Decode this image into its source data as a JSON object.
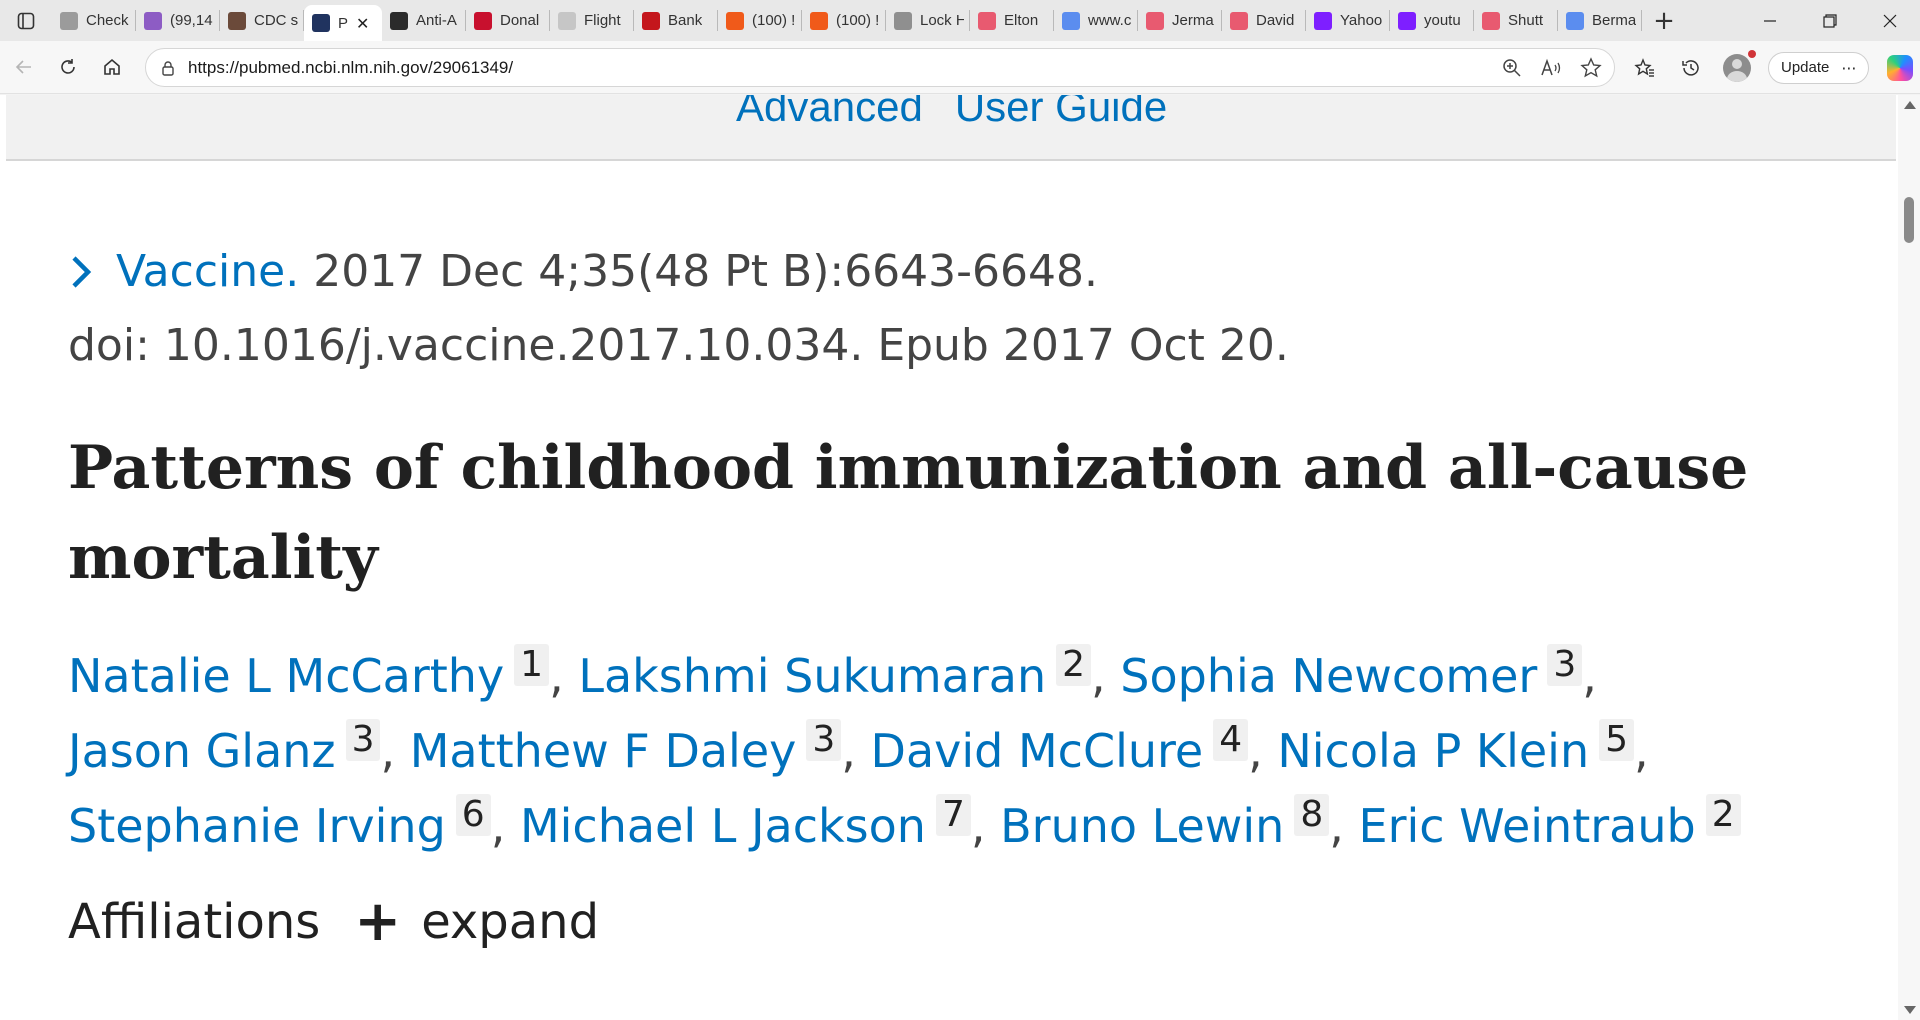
{
  "tabs": [
    {
      "title": "Check",
      "icon": "card-icon",
      "color": "#9b9b9b"
    },
    {
      "title": "(99,14",
      "icon": "mail-icon",
      "color": "#8d5cc4"
    },
    {
      "title": "CDC s",
      "icon": "photo-icon",
      "color": "#6b4a3a"
    },
    {
      "title": "P",
      "icon": "pubmed-icon",
      "color": "#20335f",
      "active": true
    },
    {
      "title": "Anti-A",
      "icon": "fp-icon",
      "color": "#2b2b2b"
    },
    {
      "title": "Donal",
      "icon": "news-icon",
      "color": "#c8102e"
    },
    {
      "title": "Flight",
      "icon": "plane-icon",
      "color": "#c6c6c6"
    },
    {
      "title": "Bank",
      "icon": "bank-icon",
      "color": "#c4161c"
    },
    {
      "title": "(100) !",
      "icon": "bookmark-icon",
      "color": "#f05a1a"
    },
    {
      "title": "(100) !",
      "icon": "bookmark-icon",
      "color": "#f05a1a"
    },
    {
      "title": "Lock H",
      "icon": "gp-icon",
      "color": "#8f8f8f"
    },
    {
      "title": "Elton",
      "icon": "youtube-icon",
      "color": "#e85a70"
    },
    {
      "title": "www.c",
      "icon": "search-icon",
      "color": "#5b8def"
    },
    {
      "title": "Jerma",
      "icon": "youtube-icon",
      "color": "#e85a70"
    },
    {
      "title": "David",
      "icon": "youtube-icon",
      "color": "#e85a70"
    },
    {
      "title": "Yahoo",
      "icon": "yahoo-icon",
      "color": "#7e1fff"
    },
    {
      "title": "youtu",
      "icon": "yahoo-icon",
      "color": "#7e1fff"
    },
    {
      "title": "Shutt",
      "icon": "youtube-icon",
      "color": "#e85a70"
    },
    {
      "title": "Berma",
      "icon": "search-icon",
      "color": "#5b8def"
    }
  ],
  "toolbar": {
    "url": "https://pubmed.ncbi.nlm.nih.gov/29061349/",
    "update_label": "Update",
    "more_label": "⋯"
  },
  "search": {
    "advanced_label": "Advanced",
    "user_guide_label": "User Guide"
  },
  "article": {
    "journal": "Vaccine.",
    "citation": "2017 Dec 4;35(48 Pt B):6643-6648.",
    "doi_line": "doi: 10.1016/j.vaccine.2017.10.034. Epub 2017 Oct 20.",
    "title": "Patterns of childhood immunization and all-cause mortality",
    "authors": [
      {
        "name": "Natalie L McCarthy",
        "aff": "1",
        "sep": ","
      },
      {
        "name": "Lakshmi Sukumaran",
        "aff": "2",
        "sep": ","
      },
      {
        "name": "Sophia Newcomer",
        "aff": "3",
        "sep": ","
      },
      {
        "name": "Jason Glanz",
        "aff": "3",
        "sep": ","
      },
      {
        "name": "Matthew F Daley",
        "aff": "3",
        "sep": ","
      },
      {
        "name": "David McClure",
        "aff": "4",
        "sep": ","
      },
      {
        "name": "Nicola P Klein",
        "aff": "5",
        "sep": ","
      },
      {
        "name": "Stephanie Irving",
        "aff": "6",
        "sep": ","
      },
      {
        "name": "Michael L Jackson",
        "aff": "7",
        "sep": ","
      },
      {
        "name": "Bruno Lewin",
        "aff": "8",
        "sep": ","
      },
      {
        "name": "Eric Weintraub",
        "aff": "2",
        "sep": ""
      }
    ],
    "affiliations_label": "Affiliations",
    "expand_label": "expand",
    "expand_symbol": "+"
  },
  "colors": {
    "link": "#0071bc",
    "text": "#444444",
    "title": "#212121"
  }
}
